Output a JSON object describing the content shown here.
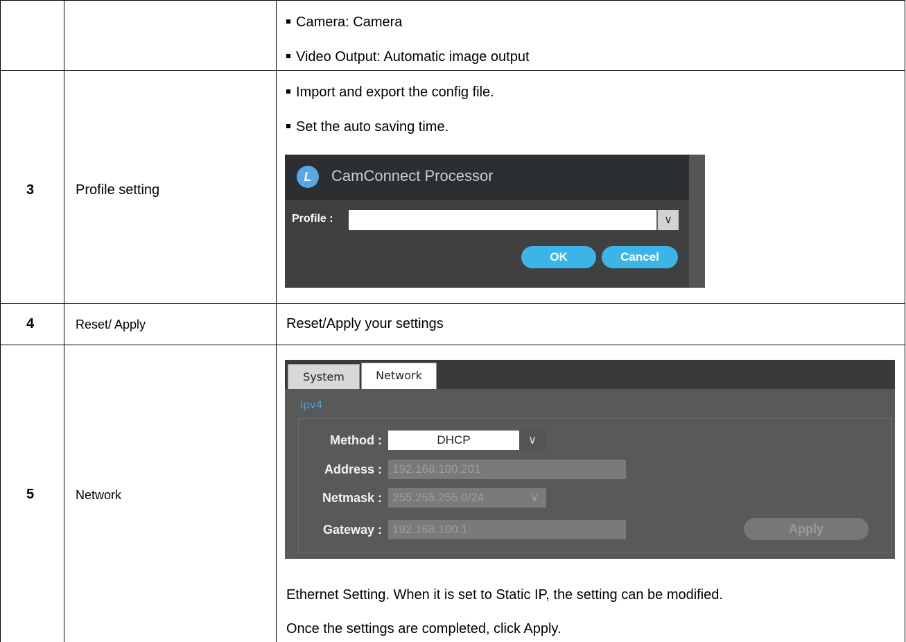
{
  "rows": [
    {
      "num": "",
      "item": "",
      "bullets": [
        "Camera: Camera",
        "Video Output: Automatic image output"
      ]
    },
    {
      "num": "3",
      "item": "Profile setting",
      "bullets": [
        "Import and export the config file.",
        "Set the auto saving time."
      ],
      "dialog": {
        "title": "CamConnect Processor",
        "profile_label": "Profile :",
        "profile_value": "",
        "ok_label": "OK",
        "cancel_label": "Cancel"
      }
    },
    {
      "num": "4",
      "item": "Reset/ Apply",
      "description": "Reset/Apply your settings"
    },
    {
      "num": "5",
      "item": "Network",
      "panel": {
        "tabs": [
          "System",
          "Network"
        ],
        "active_tab": "Network",
        "section": "Ipv4",
        "method_label": "Method :",
        "method_value": "DHCP",
        "address_label": "Address :",
        "address_value": "192.168.100.201",
        "netmask_label": "Netmask :",
        "netmask_value": "255.255.255.0/24",
        "gateway_label": "Gateway :",
        "gateway_value": "192.168.100.1",
        "apply_label": "Apply"
      },
      "description_lines": [
        "Ethernet Setting. When it is set to Static IP, the setting can be modified.",
        "Once the settings are completed, click Apply."
      ]
    }
  ],
  "colors": {
    "accent_blue": "#3cb4e8",
    "dialog_bg": "#404040",
    "panel_bg": "#595959"
  }
}
